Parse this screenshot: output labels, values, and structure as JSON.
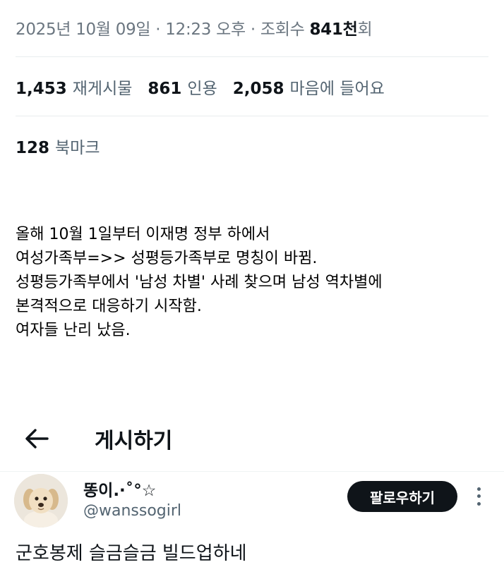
{
  "meta": {
    "datetime": "2025년 10월 09일 · 12:23 오후 · 조회수 ",
    "views": "841천",
    "views_suffix": "회"
  },
  "stats": {
    "reposts_count": "1,453",
    "reposts_label": "재게시물",
    "quotes_count": "861",
    "quotes_label": "인용",
    "likes_count": "2,058",
    "likes_label": "마음에 들어요"
  },
  "bookmarks": {
    "count": "128",
    "label": "북마크"
  },
  "body_lines": [
    "올해 10월 1일부터 이재명 정부 하에서",
    "여성가족부=>> 성평등가족부로 명칭이 바뀜.",
    "성평등가족부에서 '남성 차별' 사례 찾으며 남성 역차별에",
    "본격적으로 대응하기 시작함.",
    "여자들 난리 났음."
  ],
  "post_header": {
    "back_icon": "arrow-left-icon",
    "title": "게시하기"
  },
  "user": {
    "name": "똥이.·˚°☆",
    "handle": "@wanssogirl",
    "follow_label": "팔로우하기"
  },
  "reply_text": "군호봉제 슬금슬금 빌드업하네"
}
